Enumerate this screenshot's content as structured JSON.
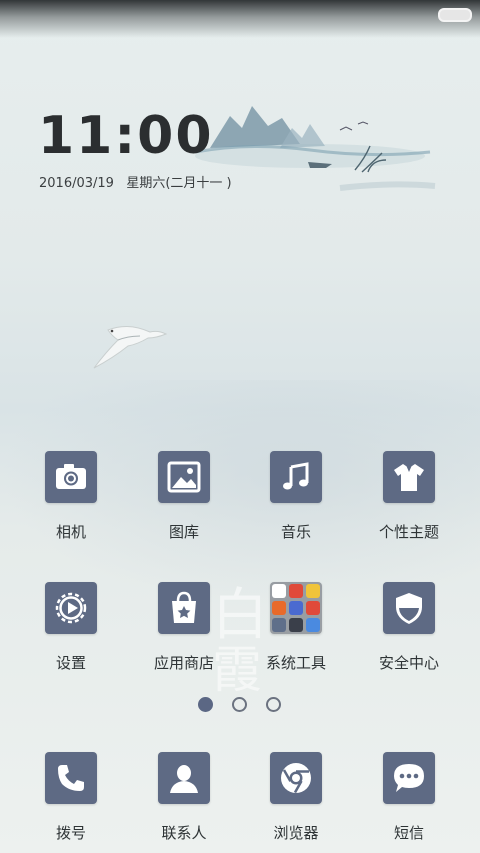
{
  "clock": {
    "time": "11:00",
    "date": "2016/03/19   星期六(二月十一 )"
  },
  "apps": {
    "row1": [
      {
        "label": "相机",
        "icon": "camera-icon"
      },
      {
        "label": "图库",
        "icon": "gallery-icon"
      },
      {
        "label": "音乐",
        "icon": "music-icon"
      },
      {
        "label": "个性主题",
        "icon": "theme-shirt-icon"
      }
    ],
    "row2": [
      {
        "label": "设置",
        "icon": "settings-gear-icon"
      },
      {
        "label": "应用商店",
        "icon": "app-store-bag-icon"
      },
      {
        "label": "系统工具",
        "icon": "system-tools-folder-icon"
      },
      {
        "label": "安全中心",
        "icon": "security-shield-icon"
      }
    ]
  },
  "dock": [
    {
      "label": "拨号",
      "icon": "phone-icon"
    },
    {
      "label": "联系人",
      "icon": "contacts-icon"
    },
    {
      "label": "浏览器",
      "icon": "browser-icon"
    },
    {
      "label": "短信",
      "icon": "messages-icon"
    }
  ],
  "wallpaper": {
    "calligraphy_1": "白",
    "calligraphy_2": "霞"
  },
  "pager": {
    "current": 1,
    "total": 3
  },
  "colors": {
    "tile": "#5e6a84",
    "dot_active": "#5b6784",
    "folder_minis": [
      "#ffffff",
      "#e04a3a",
      "#f0c43a",
      "#e86a2a",
      "#4a6ad0",
      "#e04a3a",
      "#5f6f8a",
      "#3a3f4a",
      "#4a8ae0"
    ]
  }
}
